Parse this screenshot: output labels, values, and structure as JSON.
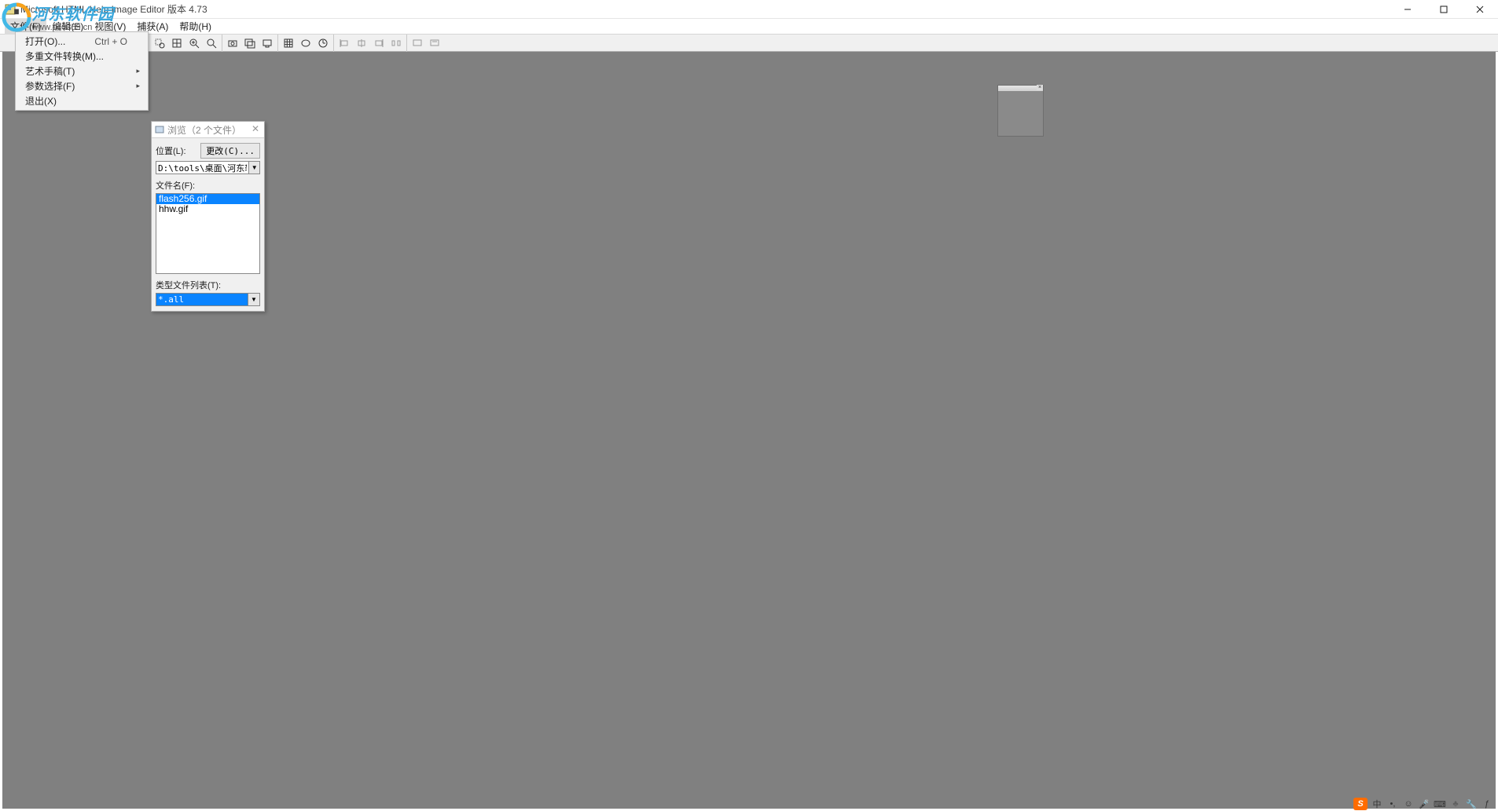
{
  "watermark": {
    "cn": "河东软件园",
    "url": "www.pc0359.cn"
  },
  "title": "Microsoft HTML Help Image Editor 版本 4.73",
  "menubar": {
    "file": "文件(F)",
    "edit": "编辑(E)",
    "view": "视图(V)",
    "capture": "捕获(A)",
    "help": "帮助(H)"
  },
  "filemenu": {
    "open": "打开(O)...",
    "open_shortcut": "Ctrl + O",
    "multi_convert": "多重文件转换(M)...",
    "art_manuscript": "艺术手稿(T)",
    "param_choice": "参数选择(F)",
    "exit": "退出(X)"
  },
  "dialog": {
    "title": "浏览（2 个文件）",
    "location_label": "位置(L):",
    "change_btn": "更改(C)...",
    "path": "D:\\tools\\桌面\\河东软件园\\M",
    "filename_label": "文件名(F):",
    "files": [
      "flash256.gif",
      "hhw.gif"
    ],
    "typelist_label": "类型文件列表(T):",
    "type_value": "*.all"
  },
  "tray": {
    "ime": "中",
    "sogou": "S"
  }
}
